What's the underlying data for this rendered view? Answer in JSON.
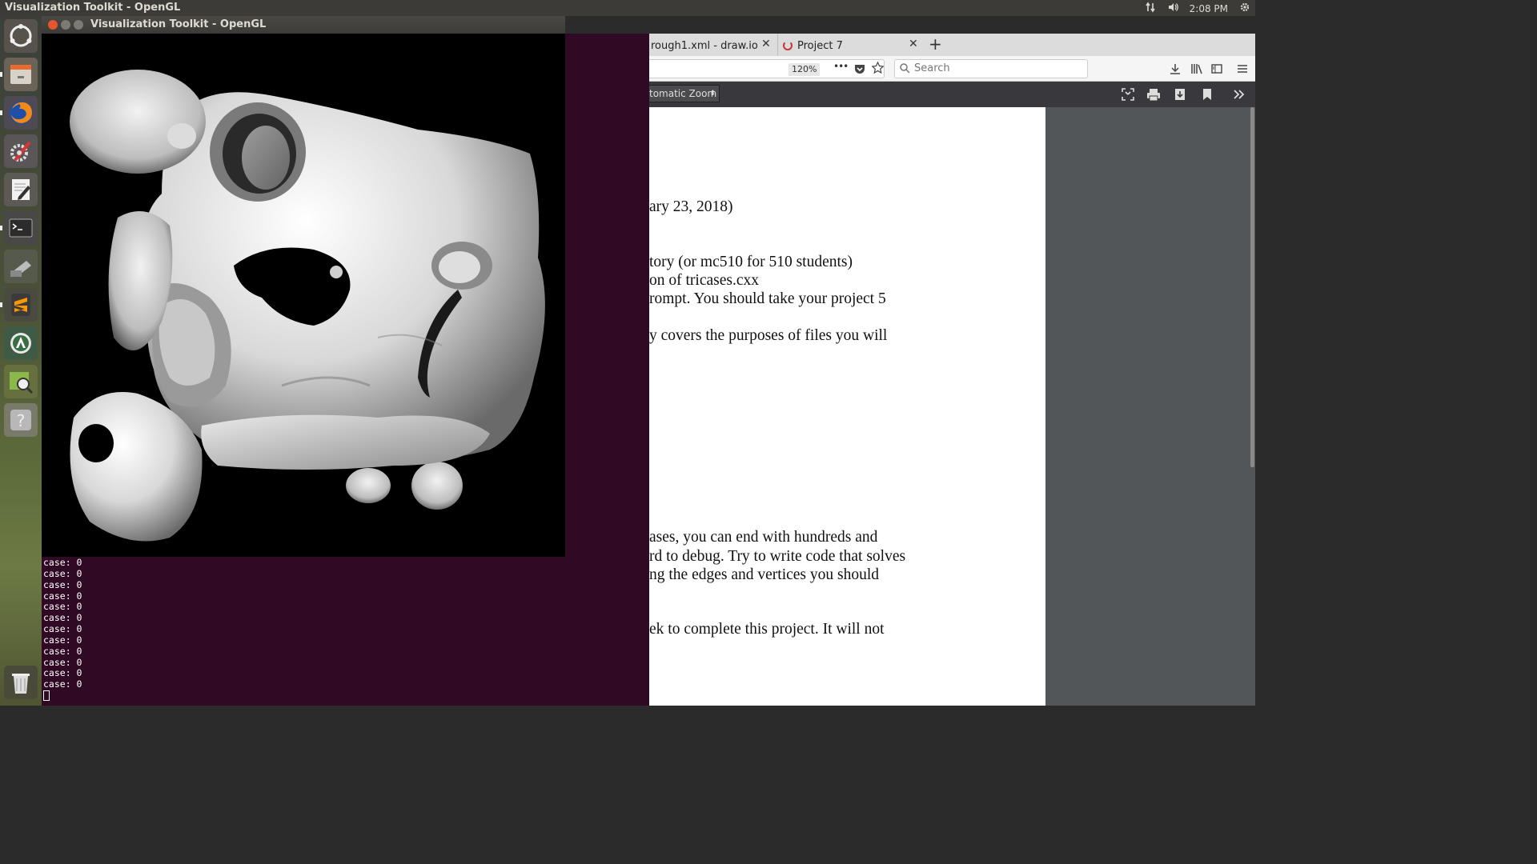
{
  "topbar": {
    "app_title": "Visualization Toolkit - OpenGL",
    "clock": "2:08 PM",
    "icons": [
      "network-icon",
      "volume-icon",
      "settings-gear-icon"
    ]
  },
  "launcher": {
    "items": [
      {
        "name": "ubuntu-dash-icon"
      },
      {
        "name": "files-icon"
      },
      {
        "name": "firefox-icon"
      },
      {
        "name": "system-settings-icon"
      },
      {
        "name": "text-editor-icon"
      },
      {
        "name": "terminal-icon"
      },
      {
        "name": "scanner-icon"
      },
      {
        "name": "sublime-text-icon"
      },
      {
        "name": "software-updater-icon"
      },
      {
        "name": "image-viewer-icon"
      },
      {
        "name": "help-icon"
      },
      {
        "name": "trash-icon"
      }
    ]
  },
  "vtk_window": {
    "title": "Visualization Toolkit - OpenGL",
    "background": "#000000",
    "surface_color": "#e8e8e8"
  },
  "terminal": {
    "lines": [
      "case: 0",
      "case: 0",
      "case: 0",
      "case: 0",
      "case: 0",
      "case: 0",
      "case: 0",
      "case: 0",
      "case: 0",
      "case: 0",
      "case: 0",
      "case: 0"
    ]
  },
  "browser": {
    "tabs": [
      {
        "label": "rough1.xml - draw.io"
      },
      {
        "label": "Project 7"
      }
    ],
    "new_tab": "+",
    "zoom": "120%",
    "more": "•••",
    "search_placeholder": "Search",
    "pdf_zoom_select": "tomatic Zoom",
    "page_lines": [
      "ary 23, 2018)",
      "tory (or mc510 for 510 students)",
      "on of tricases.cxx",
      "rompt.  You should take your project 5",
      "y covers the purposes of files you will",
      "ases, you can end with hundreds and",
      "rd to debug.  Try to write code that solves",
      "ng the edges and vertices you should",
      "ek to complete this project.  It will not"
    ]
  }
}
